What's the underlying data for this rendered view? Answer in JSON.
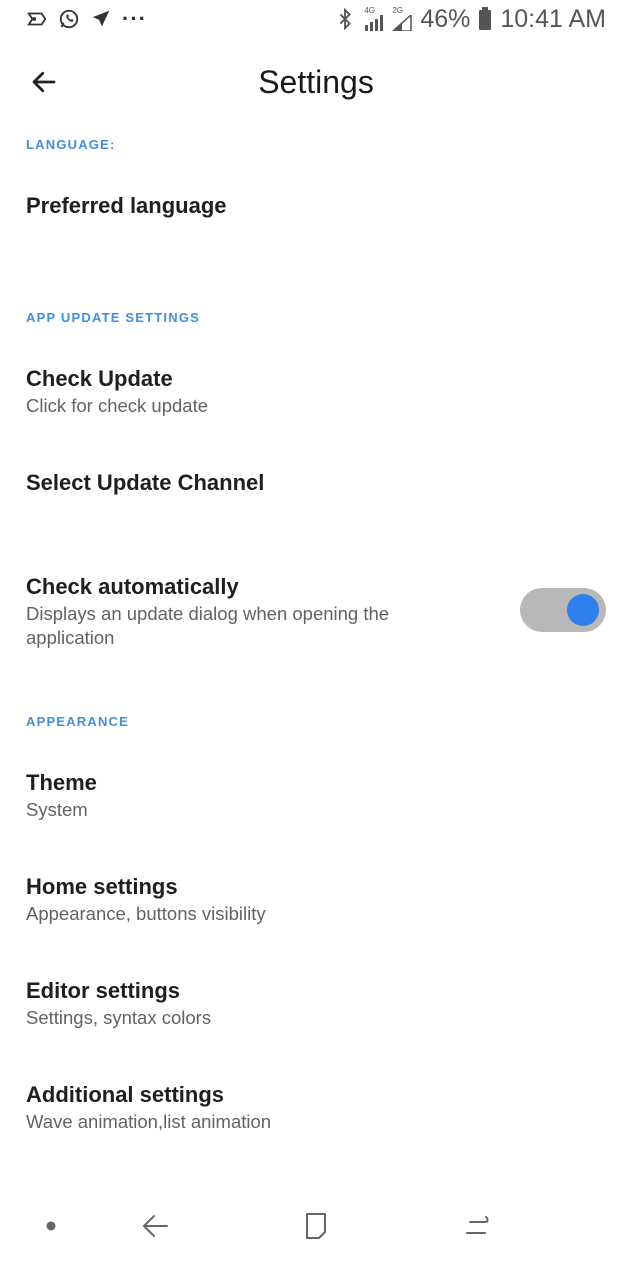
{
  "status_bar": {
    "battery": "46%",
    "time": "10:41 AM",
    "network_4g": "4G",
    "network_2g": "2G",
    "more_dots": "···",
    "icons": [
      "cast-icon",
      "whatsapp-icon",
      "navigation-icon",
      "bluetooth-icon",
      "signal-icon",
      "battery-icon"
    ]
  },
  "app_bar": {
    "title": "Settings",
    "back_icon": "arrow-back-icon"
  },
  "sections": {
    "language": {
      "header": "LANGUAGE:",
      "preferred_language": {
        "title": "Preferred language"
      }
    },
    "app_update": {
      "header": "APP UPDATE SETTINGS",
      "check_update": {
        "title": "Check Update",
        "summary": "Click for check update"
      },
      "select_channel": {
        "title": "Select Update Channel"
      },
      "check_automatically": {
        "title": "Check automatically",
        "summary": "Displays an update dialog when opening the application",
        "enabled": true
      }
    },
    "appearance": {
      "header": "APPEARANCE",
      "theme": {
        "title": "Theme",
        "summary": "System"
      },
      "home_settings": {
        "title": "Home settings",
        "summary": "Appearance, buttons visibility"
      },
      "editor_settings": {
        "title": "Editor settings",
        "summary": "Settings, syntax colors"
      },
      "additional_settings": {
        "title": "Additional settings",
        "summary": "Wave animation,list animation"
      }
    }
  },
  "colors": {
    "accent": "#3f8fe0",
    "toggle_thumb": "#2f80ed",
    "toggle_track": "#b8b8b8"
  },
  "nav_bar": {
    "icons": [
      "dot-icon",
      "nav-back-icon",
      "recents-icon",
      "menu-icon"
    ]
  }
}
